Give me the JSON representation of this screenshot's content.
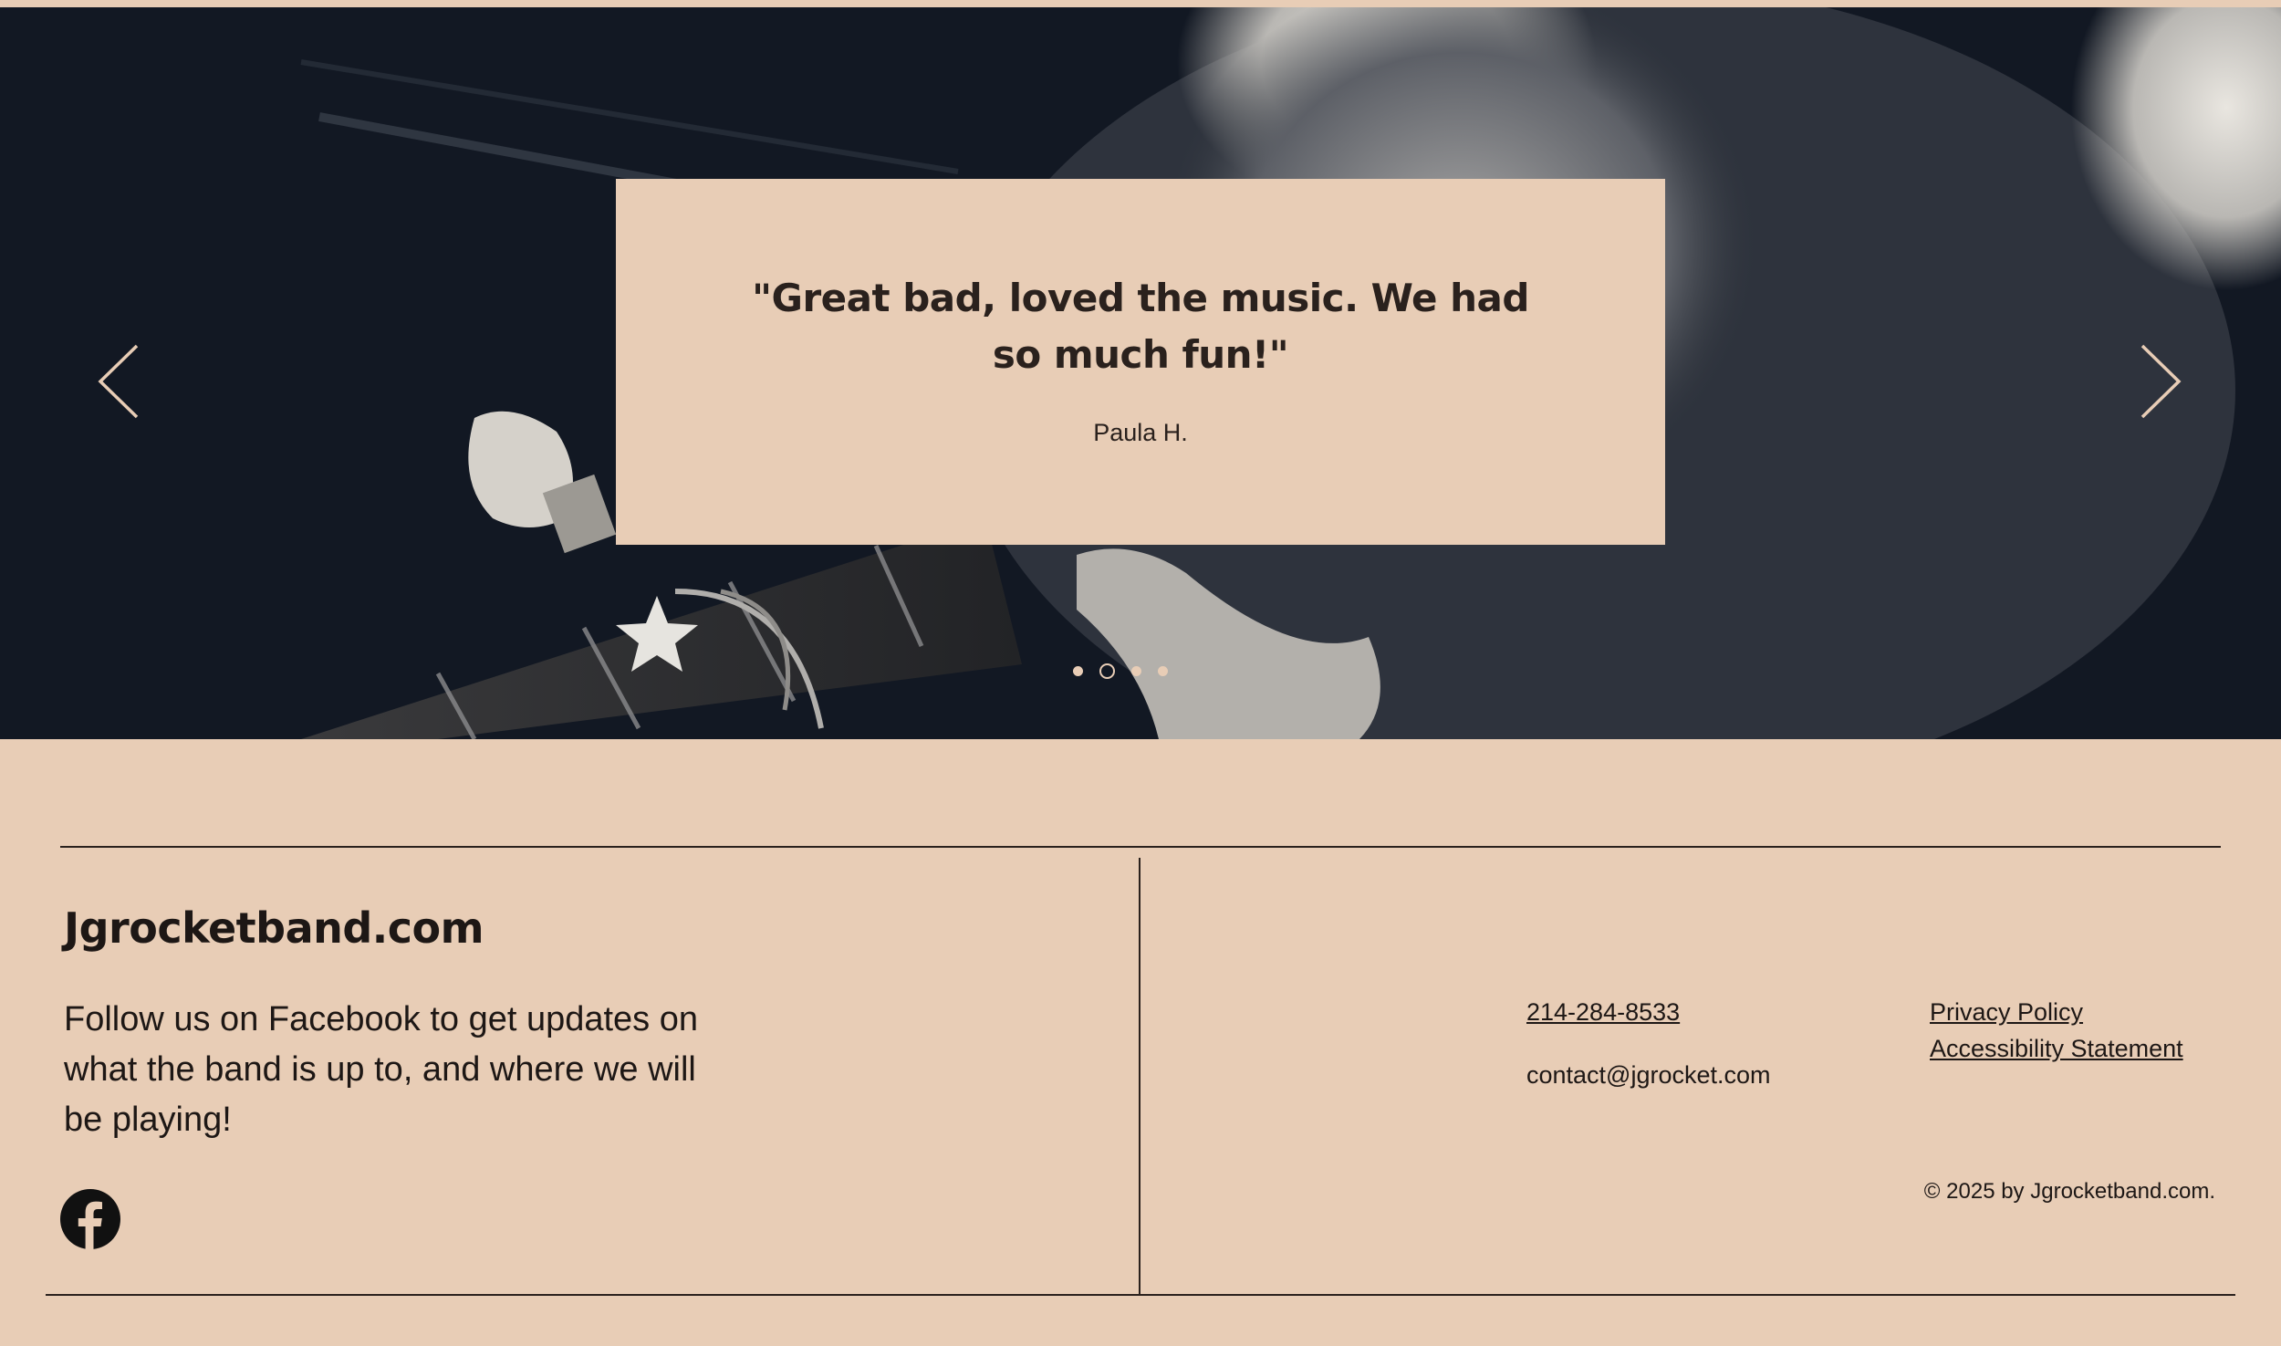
{
  "carousel": {
    "quote": "\"Great bad, loved the music. We had so much fun!\"",
    "author": "Paula H.",
    "prev_icon": "chevron-left-icon",
    "next_icon": "chevron-right-icon",
    "total_slides": 4,
    "active_slide": 2
  },
  "footer": {
    "brand": "Jgrocketband.com",
    "follow_text": "Follow us on Facebook to get updates on what the band is up to, and where we will be playing!",
    "social_icon": "facebook-icon",
    "phone": "214-284-8533",
    "email": "contact@jgrocket.com",
    "privacy_label": "Privacy Policy",
    "accessibility_label": "Accessibility Statement",
    "copyright": "© 2025 by Jgrocketband.com."
  },
  "colors": {
    "background": "#e8cdb6",
    "text": "#1d1715",
    "hero_dark": "#121823"
  }
}
